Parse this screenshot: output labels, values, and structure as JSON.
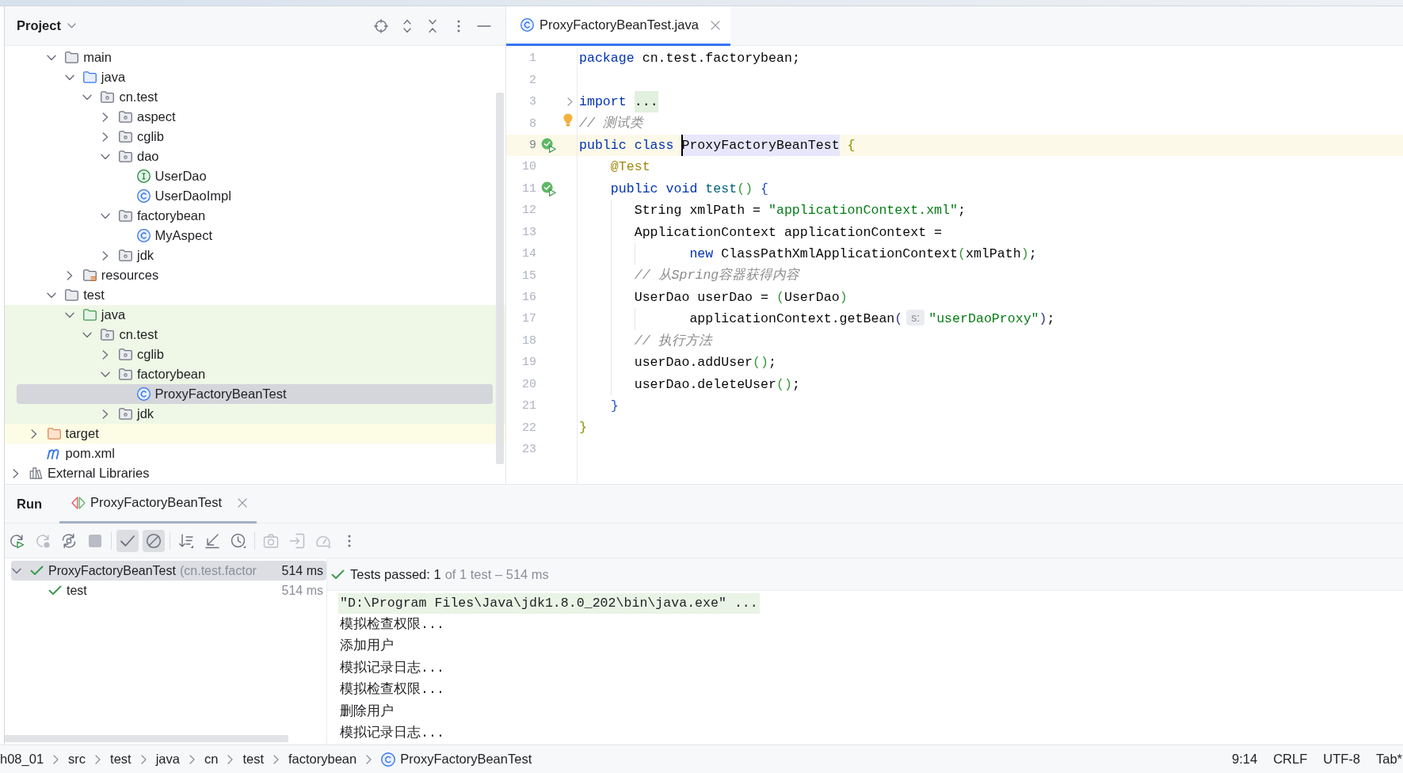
{
  "project": {
    "title": "Project",
    "tree": [
      {
        "children": [
          {
            "children": [
              {
                "label": "main",
                "kind": "folder",
                "expanded": true,
                "selected": false,
                "children": [
                  {
                    "label": "java",
                    "kind": "source_root",
                    "expanded": true,
                    "selected": false,
                    "children": [
                      {
                        "label": "cn.test",
                        "kind": "package",
                        "expanded": true,
                        "selected": false,
                        "children": [
                          {
                            "label": "aspect",
                            "kind": "package",
                            "expanded": false,
                            "selected": false
                          },
                          {
                            "label": "cglib",
                            "kind": "package",
                            "expanded": false,
                            "selected": false
                          },
                          {
                            "label": "dao",
                            "kind": "package",
                            "expanded": true,
                            "selected": false,
                            "children": [
                              {
                                "label": "UserDao",
                                "kind": "interface",
                                "selected": false
                              },
                              {
                                "label": "UserDaoImpl",
                                "kind": "class",
                                "selected": false
                              }
                            ]
                          },
                          {
                            "label": "factorybean",
                            "kind": "package",
                            "expanded": true,
                            "selected": false,
                            "children": [
                              {
                                "label": "MyAspect",
                                "kind": "class",
                                "selected": false
                              }
                            ]
                          },
                          {
                            "label": "jdk",
                            "kind": "package",
                            "expanded": false,
                            "selected": false
                          }
                        ]
                      }
                    ]
                  },
                  {
                    "label": "resources",
                    "kind": "resources_root",
                    "expanded": false,
                    "selected": false
                  }
                ]
              },
              {
                "label": "test",
                "kind": "folder",
                "expanded": true,
                "selected": false,
                "children": [
                  {
                    "label": "java",
                    "kind": "test_root",
                    "color": "#eff7e6",
                    "expanded": true,
                    "selected": false,
                    "children": [
                      {
                        "label": "cn.test",
                        "kind": "package",
                        "expanded": true,
                        "selected": false,
                        "children": [
                          {
                            "label": "cglib",
                            "kind": "package",
                            "expanded": false,
                            "selected": false
                          },
                          {
                            "label": "factorybean",
                            "kind": "package",
                            "expanded": true,
                            "selected": false,
                            "children": [
                              {
                                "label": "ProxyFactoryBeanTest",
                                "kind": "class",
                                "selected": true
                              }
                            ]
                          },
                          {
                            "label": "jdk",
                            "kind": "package",
                            "expanded": false,
                            "selected": false
                          }
                        ]
                      }
                    ]
                  }
                ]
              }
            ]
          },
          {
            "label": "target",
            "kind": "excluded_folder",
            "color": "#fdfce4",
            "expanded": false,
            "selected": false
          },
          {
            "label": "pom.xml",
            "kind": "maven_file",
            "selected": false
          }
        ]
      },
      {
        "label": "External Libraries",
        "kind": "libraries",
        "expanded": false,
        "selected": false
      }
    ]
  },
  "editor": {
    "tabs": [
      {
        "label": "ProxyFactoryBeanTest.java",
        "kind": "class",
        "selected": true
      }
    ],
    "lines": [
      {
        "number": "1",
        "current": false,
        "tokens": [
          {
            "text": "package",
            "kind": "keyword"
          },
          {
            "text": " cn.test.factorybean;",
            "kind": "plain"
          }
        ]
      },
      {
        "number": "2",
        "current": false
      },
      {
        "number": "3",
        "current": false,
        "folded": true,
        "tokens": [
          {
            "text": "import ",
            "kind": "keyword"
          },
          {
            "text": "...",
            "kind": "folded"
          }
        ]
      },
      {
        "number": "8",
        "current": false,
        "intention_bulb": true,
        "tokens": [
          {
            "text": "// 测试类",
            "kind": "comment"
          }
        ]
      },
      {
        "number": "9",
        "current": true,
        "runnable": true,
        "tokens": [
          {
            "text": "public class ",
            "kind": "keyword"
          },
          {
            "text": "ProxyFactoryBeanTest",
            "kind": "identifier",
            "caret": true
          },
          {
            "text": " {",
            "kind": "brace1"
          }
        ],
        "children": [
          {
            "number": "10",
            "current": false,
            "tokens": [
              {
                "text": "@Test",
                "kind": "annotation"
              }
            ]
          },
          {
            "number": "11",
            "current": false,
            "runnable": true,
            "tokens": [
              {
                "text": "public void ",
                "kind": "keyword"
              },
              {
                "text": "test",
                "kind": "method"
              },
              {
                "text": "()",
                "kind": "paren1"
              },
              {
                "text": " {",
                "kind": "brace2"
              }
            ],
            "children": [
              {
                "number": "12",
                "current": false,
                "tokens": [
                  {
                    "text": "String xmlPath = ",
                    "kind": "plain"
                  },
                  {
                    "text": "\"applicationContext.xml\"",
                    "kind": "string"
                  },
                  {
                    "text": ";",
                    "kind": "plain"
                  }
                ]
              },
              {
                "number": "13",
                "current": false,
                "tokens": [
                  {
                    "text": "ApplicationContext applicationContext =",
                    "kind": "plain"
                  }
                ],
                "children": [
                  {
                    "number": "14",
                    "current": false,
                    "tokens": [
                      {
                        "text": "new",
                        "kind": "keyword"
                      },
                      {
                        "text": " ClassPathXmlApplicationContext",
                        "kind": "plain"
                      },
                      {
                        "text": "(",
                        "kind": "paren1"
                      },
                      {
                        "text": "xmlPath",
                        "kind": "plain"
                      },
                      {
                        "text": ")",
                        "kind": "paren1"
                      },
                      {
                        "text": ";",
                        "kind": "plain"
                      }
                    ]
                  }
                ]
              },
              {
                "number": "15",
                "current": false,
                "tokens": [
                  {
                    "text": "// 从Spring容器获得内容",
                    "kind": "comment"
                  }
                ]
              },
              {
                "number": "16",
                "current": false,
                "tokens": [
                  {
                    "text": "UserDao userDao = ",
                    "kind": "plain"
                  },
                  {
                    "text": "(",
                    "kind": "paren1"
                  },
                  {
                    "text": "UserDao",
                    "kind": "plain"
                  },
                  {
                    "text": ")",
                    "kind": "paren1"
                  }
                ],
                "children": [
                  {
                    "number": "17",
                    "current": false,
                    "tokens": [
                      {
                        "text": "applicationContext.getBean",
                        "kind": "plain"
                      },
                      {
                        "text": "(",
                        "kind": "paren2"
                      },
                      {
                        "text": "s:",
                        "kind": "hint"
                      },
                      {
                        "text": "\"userDaoProxy\"",
                        "kind": "string"
                      },
                      {
                        "text": ")",
                        "kind": "paren2"
                      },
                      {
                        "text": ";",
                        "kind": "plain"
                      }
                    ]
                  }
                ]
              },
              {
                "number": "18",
                "current": false,
                "tokens": [
                  {
                    "text": "// 执行方法",
                    "kind": "comment"
                  }
                ]
              },
              {
                "number": "19",
                "current": false,
                "tokens": [
                  {
                    "text": "userDao.addUser",
                    "kind": "plain"
                  },
                  {
                    "text": "()",
                    "kind": "paren1"
                  },
                  {
                    "text": ";",
                    "kind": "plain"
                  }
                ]
              },
              {
                "number": "20",
                "current": false,
                "tokens": [
                  {
                    "text": "userDao.deleteUser",
                    "kind": "plain"
                  },
                  {
                    "text": "()",
                    "kind": "paren1"
                  },
                  {
                    "text": ";",
                    "kind": "plain"
                  }
                ]
              }
            ]
          },
          {
            "number": "21",
            "current": false,
            "tokens": [
              {
                "text": "}",
                "kind": "brace2"
              }
            ]
          }
        ]
      },
      {
        "number": "22",
        "current": false,
        "tokens": [
          {
            "text": "}",
            "kind": "brace1"
          }
        ]
      },
      {
        "number": "23",
        "current": false
      }
    ]
  },
  "run": {
    "title": "Run",
    "tabs": [
      {
        "label": "ProxyFactoryBeanTest",
        "selected": true
      }
    ],
    "toolbar": [
      {
        "on": false,
        "disabled": false
      },
      {
        "on": false,
        "disabled": true
      },
      {
        "on": false,
        "disabled": false
      },
      {
        "on": false,
        "disabled": true
      },
      {
        "on": true,
        "disabled": false
      },
      {
        "on": true,
        "disabled": false
      },
      {
        "on": false,
        "disabled": false
      },
      {
        "on": false,
        "disabled": false
      },
      {
        "on": false,
        "disabled": false
      },
      {
        "on": false,
        "disabled": true
      },
      {
        "on": false,
        "disabled": true
      },
      {
        "on": false,
        "disabled": true
      },
      {
        "on": false,
        "disabled": false
      }
    ],
    "tests": [
      {
        "label": "ProxyFactoryBeanTest",
        "detail": "(cn.test.factor",
        "time": "514 ms",
        "passed": true,
        "expanded": true,
        "selected": true,
        "children": [
          {
            "label": "test",
            "time": "514 ms",
            "passed": true,
            "selected": false
          }
        ]
      }
    ],
    "summary": {
      "passed": true,
      "title": "Tests passed: 1",
      "detail": "of 1 test – 514 ms"
    },
    "console": [
      {
        "text": "\"D:\\Program Files\\Java\\jdk1.8.0_202\\bin\\java.exe\" ...",
        "kind": "command"
      },
      {
        "text": "模拟检查权限...",
        "kind": "output"
      },
      {
        "text": "添加用户",
        "kind": "output"
      },
      {
        "text": "模拟记录日志...",
        "kind": "output"
      },
      {
        "text": "模拟检查权限...",
        "kind": "output"
      },
      {
        "text": "删除用户",
        "kind": "output"
      },
      {
        "text": "模拟记录日志...",
        "kind": "output"
      }
    ]
  },
  "status_bar": {
    "breadcrumbs": [
      {
        "label": "h08_01",
        "kind": "path"
      },
      {
        "label": "src",
        "kind": "path"
      },
      {
        "label": "test",
        "kind": "path"
      },
      {
        "label": "java",
        "kind": "path"
      },
      {
        "label": "cn",
        "kind": "path"
      },
      {
        "label": "test",
        "kind": "path"
      },
      {
        "label": "factorybean",
        "kind": "path"
      },
      {
        "label": "ProxyFactoryBeanTest",
        "kind": "class"
      }
    ],
    "items": [
      "9:14",
      "CRLF",
      "UTF-8",
      "Tab*"
    ]
  }
}
